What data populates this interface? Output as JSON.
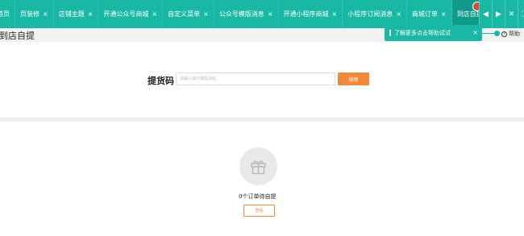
{
  "tabs": [
    {
      "label": "首页",
      "closable": false,
      "active": false
    },
    {
      "label": "页装修",
      "closable": true,
      "active": false
    },
    {
      "label": "店铺主题",
      "closable": true,
      "active": false
    },
    {
      "label": "开通公众号商城",
      "closable": true,
      "active": false
    },
    {
      "label": "自定义菜单",
      "closable": true,
      "active": false
    },
    {
      "label": "公众号模版消息",
      "closable": true,
      "active": false
    },
    {
      "label": "开通小程序商城",
      "closable": true,
      "active": false
    },
    {
      "label": "小程序订阅消息",
      "closable": true,
      "active": false
    },
    {
      "label": "商城订单",
      "closable": true,
      "active": false
    },
    {
      "label": "到店自提",
      "closable": false,
      "active": true
    }
  ],
  "close_glyph": "×",
  "controls": {
    "prev": "◀",
    "next": "▶",
    "close": "✕",
    "fullscreen": "⛶"
  },
  "page": {
    "title": "到店自提"
  },
  "help": {
    "label": "帮助",
    "icon": "question-circle-icon"
  },
  "tooltip": {
    "text": "了解更多点击帮助试试",
    "close": "×"
  },
  "pickup": {
    "label": "提货码",
    "placeholder": "请输入或扫描提货码",
    "button": "核销"
  },
  "empty": {
    "icon": "gift-icon",
    "text": "0个订单待自提",
    "button": "查看"
  },
  "colors": {
    "accent": "#19b8a5",
    "orange": "#f08a3a",
    "avatar": "#d64a3a"
  }
}
